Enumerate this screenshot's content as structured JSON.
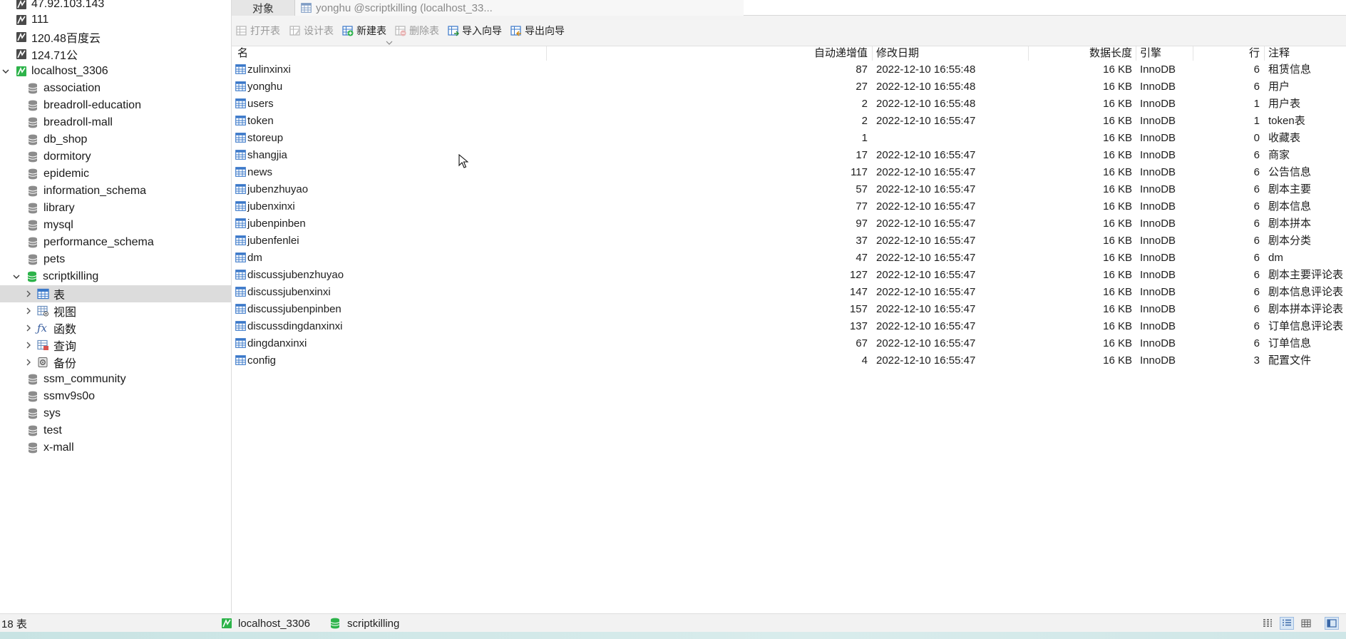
{
  "sidebar": {
    "connections": [
      {
        "label": "47.92.103.143"
      },
      {
        "label": "111"
      },
      {
        "label": "120.48百度云"
      },
      {
        "label": "124.71公"
      }
    ],
    "active_connection": "localhost_3306",
    "databases": [
      "association",
      "breadroll-education",
      "breadroll-mall",
      "db_shop",
      "dormitory",
      "epidemic",
      "information_schema",
      "library",
      "mysql",
      "performance_schema",
      "pets"
    ],
    "open_database": "scriptkilling",
    "object_groups": [
      "表",
      "视图",
      "函数",
      "查询",
      "备份"
    ],
    "databases_after": [
      "ssm_community",
      "ssmv9s0o",
      "sys",
      "test",
      "x-mall"
    ]
  },
  "tabs": {
    "objects": "对象",
    "document": "yonghu @scriptkilling (localhost_33..."
  },
  "toolbar": {
    "open_table": "打开表",
    "design_table": "设计表",
    "new_table": "新建表",
    "delete_table": "删除表",
    "import_wizard": "导入向导",
    "export_wizard": "导出向导"
  },
  "grid": {
    "columns": {
      "name": "名",
      "auto_increment": "自动递增值",
      "modified": "修改日期",
      "data_length": "数据长度",
      "engine": "引擎",
      "rows": "行",
      "comment": "注释"
    },
    "rows": [
      {
        "name": "zulinxinxi",
        "auto_increment": "87",
        "modified": "2022-12-10 16:55:48",
        "data_length": "16 KB",
        "engine": "InnoDB",
        "rows": "6",
        "comment": "租赁信息"
      },
      {
        "name": "yonghu",
        "auto_increment": "27",
        "modified": "2022-12-10 16:55:48",
        "data_length": "16 KB",
        "engine": "InnoDB",
        "rows": "6",
        "comment": "用户"
      },
      {
        "name": "users",
        "auto_increment": "2",
        "modified": "2022-12-10 16:55:48",
        "data_length": "16 KB",
        "engine": "InnoDB",
        "rows": "1",
        "comment": "用户表"
      },
      {
        "name": "token",
        "auto_increment": "2",
        "modified": "2022-12-10 16:55:47",
        "data_length": "16 KB",
        "engine": "InnoDB",
        "rows": "1",
        "comment": "token表"
      },
      {
        "name": "storeup",
        "auto_increment": "1",
        "modified": "",
        "data_length": "16 KB",
        "engine": "InnoDB",
        "rows": "0",
        "comment": "收藏表"
      },
      {
        "name": "shangjia",
        "auto_increment": "17",
        "modified": "2022-12-10 16:55:47",
        "data_length": "16 KB",
        "engine": "InnoDB",
        "rows": "6",
        "comment": "商家"
      },
      {
        "name": "news",
        "auto_increment": "117",
        "modified": "2022-12-10 16:55:47",
        "data_length": "16 KB",
        "engine": "InnoDB",
        "rows": "6",
        "comment": "公告信息"
      },
      {
        "name": "jubenzhuyao",
        "auto_increment": "57",
        "modified": "2022-12-10 16:55:47",
        "data_length": "16 KB",
        "engine": "InnoDB",
        "rows": "6",
        "comment": "剧本主要"
      },
      {
        "name": "jubenxinxi",
        "auto_increment": "77",
        "modified": "2022-12-10 16:55:47",
        "data_length": "16 KB",
        "engine": "InnoDB",
        "rows": "6",
        "comment": "剧本信息"
      },
      {
        "name": "jubenpinben",
        "auto_increment": "97",
        "modified": "2022-12-10 16:55:47",
        "data_length": "16 KB",
        "engine": "InnoDB",
        "rows": "6",
        "comment": "剧本拼本"
      },
      {
        "name": "jubenfenlei",
        "auto_increment": "37",
        "modified": "2022-12-10 16:55:47",
        "data_length": "16 KB",
        "engine": "InnoDB",
        "rows": "6",
        "comment": "剧本分类"
      },
      {
        "name": "dm",
        "auto_increment": "47",
        "modified": "2022-12-10 16:55:47",
        "data_length": "16 KB",
        "engine": "InnoDB",
        "rows": "6",
        "comment": "dm"
      },
      {
        "name": "discussjubenzhuyao",
        "auto_increment": "127",
        "modified": "2022-12-10 16:55:47",
        "data_length": "16 KB",
        "engine": "InnoDB",
        "rows": "6",
        "comment": "剧本主要评论表"
      },
      {
        "name": "discussjubenxinxi",
        "auto_increment": "147",
        "modified": "2022-12-10 16:55:47",
        "data_length": "16 KB",
        "engine": "InnoDB",
        "rows": "6",
        "comment": "剧本信息评论表"
      },
      {
        "name": "discussjubenpinben",
        "auto_increment": "157",
        "modified": "2022-12-10 16:55:47",
        "data_length": "16 KB",
        "engine": "InnoDB",
        "rows": "6",
        "comment": "剧本拼本评论表"
      },
      {
        "name": "discussdingdanxinxi",
        "auto_increment": "137",
        "modified": "2022-12-10 16:55:47",
        "data_length": "16 KB",
        "engine": "InnoDB",
        "rows": "6",
        "comment": "订单信息评论表"
      },
      {
        "name": "dingdanxinxi",
        "auto_increment": "67",
        "modified": "2022-12-10 16:55:47",
        "data_length": "16 KB",
        "engine": "InnoDB",
        "rows": "6",
        "comment": "订单信息"
      },
      {
        "name": "config",
        "auto_increment": "4",
        "modified": "2022-12-10 16:55:47",
        "data_length": "16 KB",
        "engine": "InnoDB",
        "rows": "3",
        "comment": "配置文件"
      }
    ]
  },
  "status": {
    "table_count": "18 表",
    "connection": "localhost_3306",
    "database": "scriptkilling"
  },
  "icons": {
    "connection": "mysql-connection-icon",
    "database": "database-icon",
    "table": "table-icon",
    "view": "view-icon",
    "function": "function-icon",
    "query": "query-icon",
    "backup": "backup-icon"
  },
  "colors": {
    "accent_green": "#2db34a",
    "table_icon_blue": "#3a78c9",
    "selected_row": "#dcdcdc"
  }
}
